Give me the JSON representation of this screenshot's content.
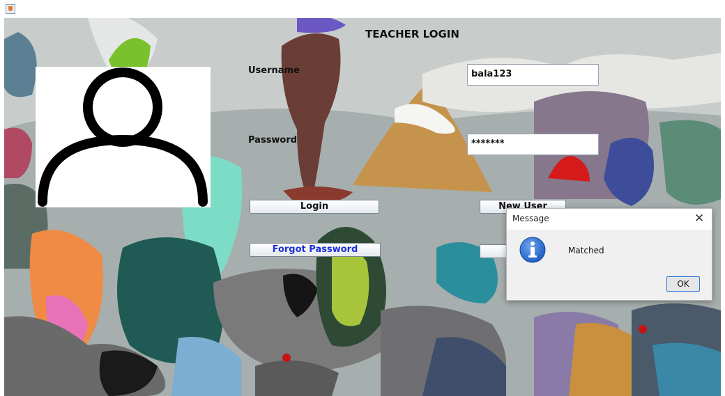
{
  "window": {
    "icon": "java-cup-icon"
  },
  "form": {
    "title": "TEACHER LOGIN",
    "avatar_icon": "user-avatar-icon",
    "username_label": "Username",
    "username_value": "bala123",
    "password_label": "Password",
    "password_value": "*******",
    "login_button": "Login",
    "new_user_button": "New User",
    "forgot_password_button": "Forgot Password"
  },
  "dialog": {
    "title": "Message",
    "close_icon": "close-icon",
    "icon": "info-icon",
    "message": "Matched",
    "ok_button": "OK"
  },
  "colors": {
    "link_blue": "#1a2fd8",
    "info_blue": "#1f5fc4",
    "focus_border": "#2b78d6"
  }
}
